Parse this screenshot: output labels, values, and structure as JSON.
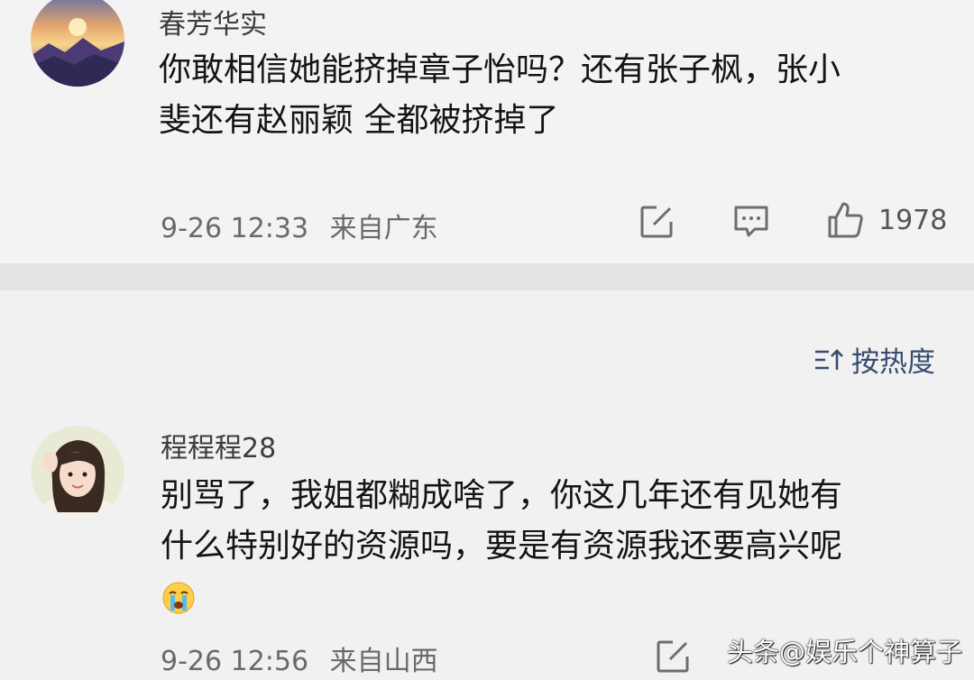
{
  "comments": [
    {
      "username": "春芳华实",
      "text_line1": "你敢相信她能挤掉章子怡吗？还有张子枫，张小",
      "text_line2": "斐还有赵丽颖 全都被挤掉了",
      "time": "9-26 12:33",
      "location": "来自广东",
      "likes": "1978",
      "avatar_icon": "sunset-mountains-avatar"
    },
    {
      "username": "程程程28",
      "text_line1": "别骂了，我姐都糊成啥了，你这几年还有见她有",
      "text_line2": "什么特别好的资源吗，要是有资源我还要高兴呢",
      "emoji": "crying-face-emoji",
      "time": "9-26 12:56",
      "location": "来自山西",
      "avatar_icon": "girl-portrait-avatar"
    }
  ],
  "sort": {
    "label": "按热度"
  },
  "watermark": "头条@娱乐个神算子",
  "colors": {
    "page_bg": "#f2f2f2",
    "separator": "#e3e3e3",
    "sort_accent": "#384c70",
    "meta_text": "#6a6a6a"
  }
}
